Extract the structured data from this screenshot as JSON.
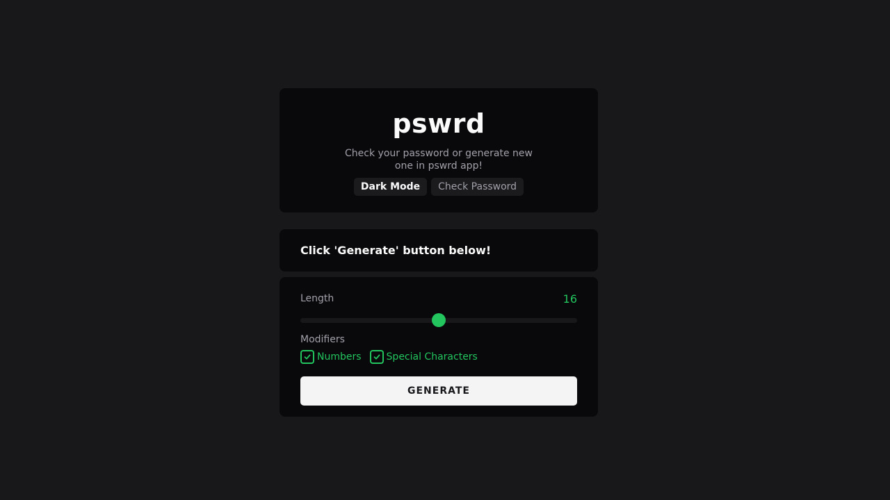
{
  "app": {
    "title": "pswrd",
    "subtitle": "Check your password or generate new one in pswrd app!",
    "buttons": {
      "dark_mode": "Dark Mode",
      "check_password": "Check Password"
    }
  },
  "status": {
    "message": "Click 'Generate' button below!"
  },
  "controls": {
    "length_label": "Length",
    "length_value": "16",
    "length_slider_fraction": 0.5,
    "modifiers_label": "Modifiers",
    "modifiers": [
      {
        "label": "Numbers",
        "checked": true
      },
      {
        "label": "Special Characters",
        "checked": true
      }
    ],
    "generate_label": "GENERATE"
  },
  "colors": {
    "background": "#18181b",
    "card": "#09090b",
    "accent": "#22c55e",
    "text": "#fafafa",
    "muted": "#a1a1aa",
    "button": "#f4f4f5"
  },
  "icons": {
    "checkbox": "check-icon"
  }
}
